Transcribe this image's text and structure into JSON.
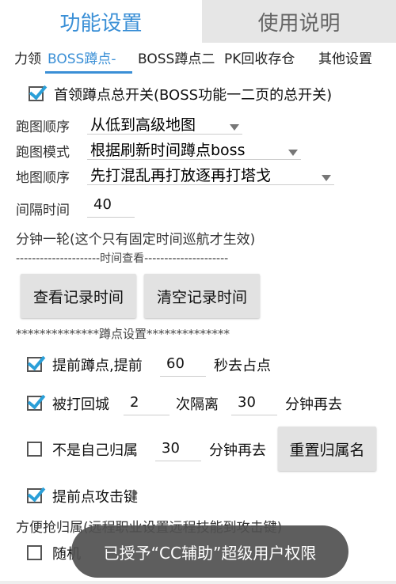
{
  "tabs": {
    "active": "功能设置",
    "inactive": "使用说明"
  },
  "subtabs": [
    "力领",
    "BOSS蹲点-",
    "BOSS蹲点二",
    "PK回收存仓",
    "其他设置"
  ],
  "master_switch": {
    "checked": true,
    "label": "首领蹲点总开关(BOSS功能一二页的总开关)"
  },
  "route_order": {
    "label": "跑图顺序",
    "value": "从低到高级地图"
  },
  "route_mode": {
    "label": "跑图模式",
    "value": "根据刷新时间蹲点boss"
  },
  "map_order": {
    "label": "地图顺序",
    "value": "先打混乱再打放逐再打塔戈"
  },
  "interval": {
    "label": "间隔时间",
    "value": "40"
  },
  "interval_note": "分钟一轮(这个只有固定时间巡航才生效)",
  "time_divider": "---------------------时间查看---------------------",
  "buttons": {
    "view_time": "查看记录时间",
    "clear_time": "清空记录时间",
    "reset_owner": "重置归属名"
  },
  "camp_divider": "**************蹲点设置**************",
  "early_camp": {
    "checked": true,
    "label": "提前蹲点,提前",
    "value": "60",
    "suffix": "秒去占点"
  },
  "killed_return": {
    "checked": true,
    "label": "被打回城",
    "count": "2",
    "mid": "次隔离",
    "minutes": "30",
    "suffix": "分钟再去"
  },
  "not_own": {
    "checked": false,
    "label": "不是自己归属",
    "minutes": "30",
    "suffix": "分钟再去"
  },
  "early_attack": {
    "checked": true,
    "label": "提前点攻击键"
  },
  "ranged_note": "方便抢归属(远程职业设置远程技能到攻击键)",
  "random": {
    "checked": false,
    "label": "随机"
  },
  "toast": "已授予“CC辅助”超级用户权限",
  "colors": {
    "accent": "#3a8fd6",
    "check": "#2a9fd8",
    "inactive_tab": "#e6e6e6",
    "toast": "#505050"
  }
}
